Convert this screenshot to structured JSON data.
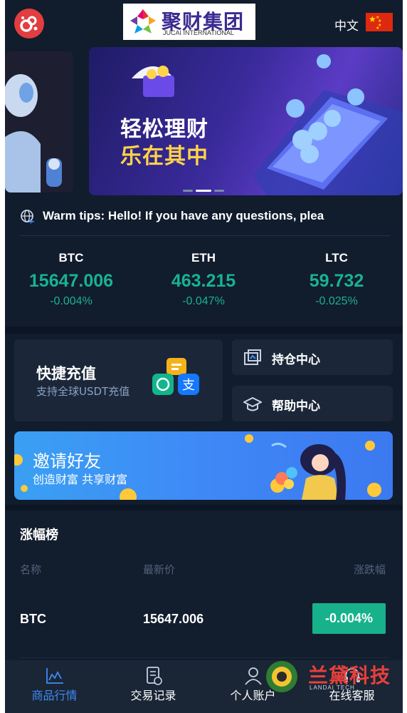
{
  "header": {
    "brand_cn": "聚财集团",
    "brand_en": "JUCAI INTERNATIONAL",
    "language": "中文"
  },
  "banner": {
    "line1": "轻松理财",
    "line2": "乐在其中",
    "slide_count": 3,
    "active_slide": 2
  },
  "notice": {
    "text": "Warm tips: Hello! If you have any questions, plea"
  },
  "tickers": [
    {
      "name": "BTC",
      "price": "15647.006",
      "change": "-0.004%"
    },
    {
      "name": "ETH",
      "price": "463.215",
      "change": "-0.047%"
    },
    {
      "name": "LTC",
      "price": "59.732",
      "change": "-0.025%"
    }
  ],
  "quick": {
    "recharge_title": "快捷充值",
    "recharge_sub": "支持全球USDT充值",
    "positions_label": "持仓中心",
    "help_label": "帮助中心",
    "pay_glyph": "支"
  },
  "invite": {
    "title": "邀请好友",
    "subtitle": "创造财富 共享财富"
  },
  "ranking": {
    "title": "涨幅榜",
    "columns": [
      "名称",
      "最新价",
      "涨跌幅"
    ],
    "rows": [
      {
        "symbol": "BTC",
        "price": "15647.006",
        "change": "-0.004%"
      }
    ]
  },
  "tabbar": {
    "items": [
      {
        "label": "商品行情",
        "icon": "chart-icon",
        "active": true
      },
      {
        "label": "交易记录",
        "icon": "document-icon",
        "active": false
      },
      {
        "label": "个人账户",
        "icon": "user-icon",
        "active": false
      },
      {
        "label": "在线客服",
        "icon": "support-icon",
        "active": false
      }
    ]
  },
  "watermark": {
    "text": "兰黛科技",
    "sub": "LANDAI TECH"
  },
  "colors": {
    "background": "#111c2d",
    "card": "#1b2739",
    "up_green": "#19b28f",
    "active_blue": "#3f8df7",
    "logo_red": "#e23d3f"
  }
}
